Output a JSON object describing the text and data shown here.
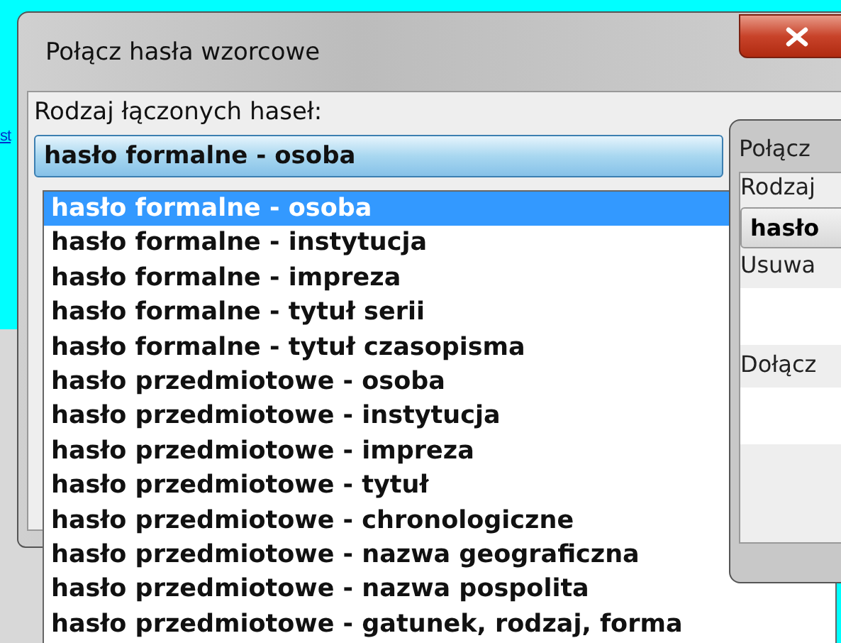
{
  "background_link": "st",
  "dialog": {
    "title": "Połącz hasła wzorcowe",
    "group_label": "Rodzaj łączonych haseł:",
    "combo_value": "hasło formalne - osoba",
    "options": [
      {
        "label": "hasło formalne - osoba",
        "selected": true
      },
      {
        "label": "hasło formalne - instytucja",
        "selected": false
      },
      {
        "label": "hasło formalne - impreza",
        "selected": false
      },
      {
        "label": "hasło formalne - tytuł serii",
        "selected": false
      },
      {
        "label": "hasło formalne - tytuł czasopisma",
        "selected": false
      },
      {
        "label": "hasło przedmiotowe - osoba",
        "selected": false
      },
      {
        "label": "hasło przedmiotowe - instytucja",
        "selected": false
      },
      {
        "label": "hasło przedmiotowe - impreza",
        "selected": false
      },
      {
        "label": "hasło przedmiotowe - tytuł",
        "selected": false
      },
      {
        "label": "hasło przedmiotowe - chronologiczne",
        "selected": false
      },
      {
        "label": "hasło przedmiotowe - nazwa geograficzna",
        "selected": false
      },
      {
        "label": "hasło przedmiotowe - nazwa pospolita",
        "selected": false
      },
      {
        "label": "hasło przedmiotowe - gatunek, rodzaj, forma",
        "selected": false
      }
    ]
  },
  "second_dialog": {
    "title": "Połącz",
    "group_label": "Rodzaj",
    "combo_value": "hasło",
    "remove_label": "Usuwa",
    "add_label": "Dołącz"
  }
}
